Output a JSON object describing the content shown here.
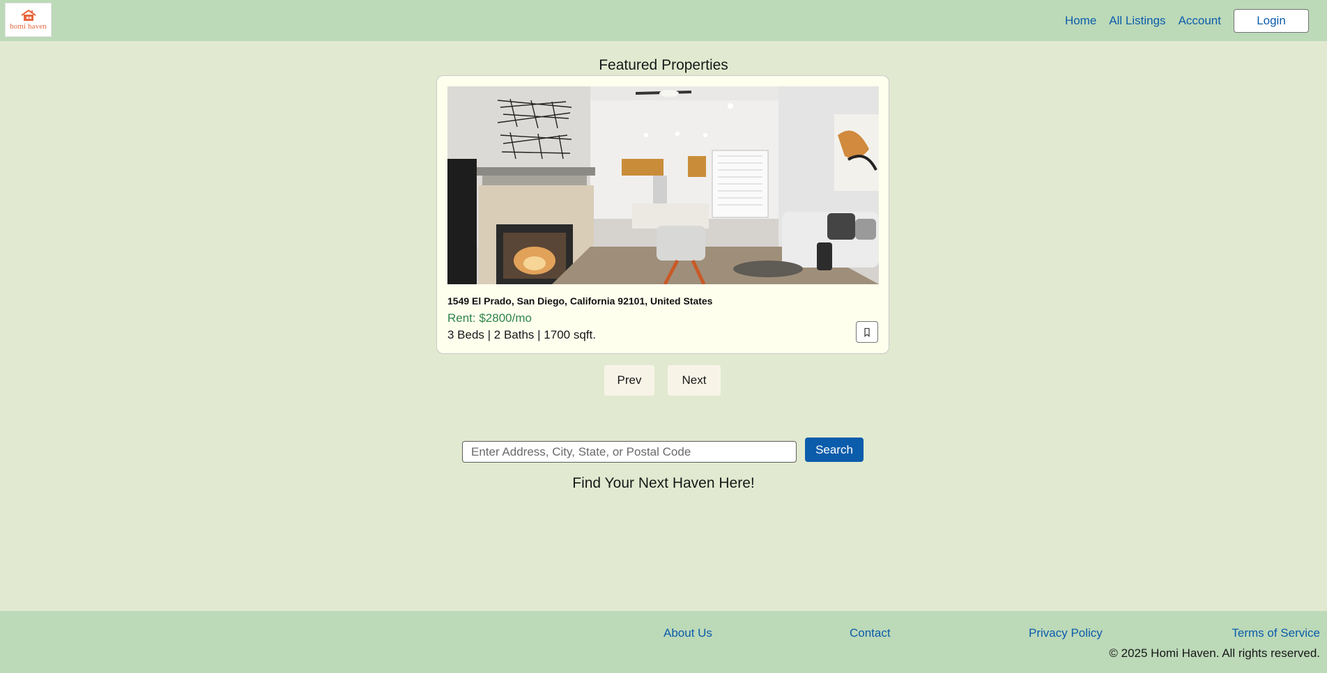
{
  "header": {
    "logo_text": "homi haven",
    "nav": {
      "home": "Home",
      "all_listings": "All Listings",
      "account": "Account",
      "login": "Login"
    }
  },
  "featured": {
    "title": "Featured Properties",
    "property": {
      "address": "1549 El Prado, San Diego, California 92101, United States",
      "rent": "Rent: $2800/mo",
      "specs": "3 Beds | 2 Baths | 1700 sqft."
    },
    "prev_label": "Prev",
    "next_label": "Next"
  },
  "search": {
    "placeholder": "Enter Address, City, State, or Postal Code",
    "value": "",
    "button_label": "Search",
    "tagline": "Find Your Next Haven Here!"
  },
  "footer": {
    "about": "About Us",
    "contact": "Contact",
    "privacy": "Privacy Policy",
    "terms": "Terms of Service",
    "copyright": "© 2025 Homi Haven. All rights reserved."
  },
  "colors": {
    "header_bg": "#bcd9b8",
    "page_bg": "#e1ead0",
    "link": "#0b5cab",
    "rent": "#2e844a",
    "brand": "#e8663d",
    "card_bg": "#ffffee"
  },
  "icons": {
    "logo": "house-icon",
    "bookmark": "bookmark-icon"
  }
}
